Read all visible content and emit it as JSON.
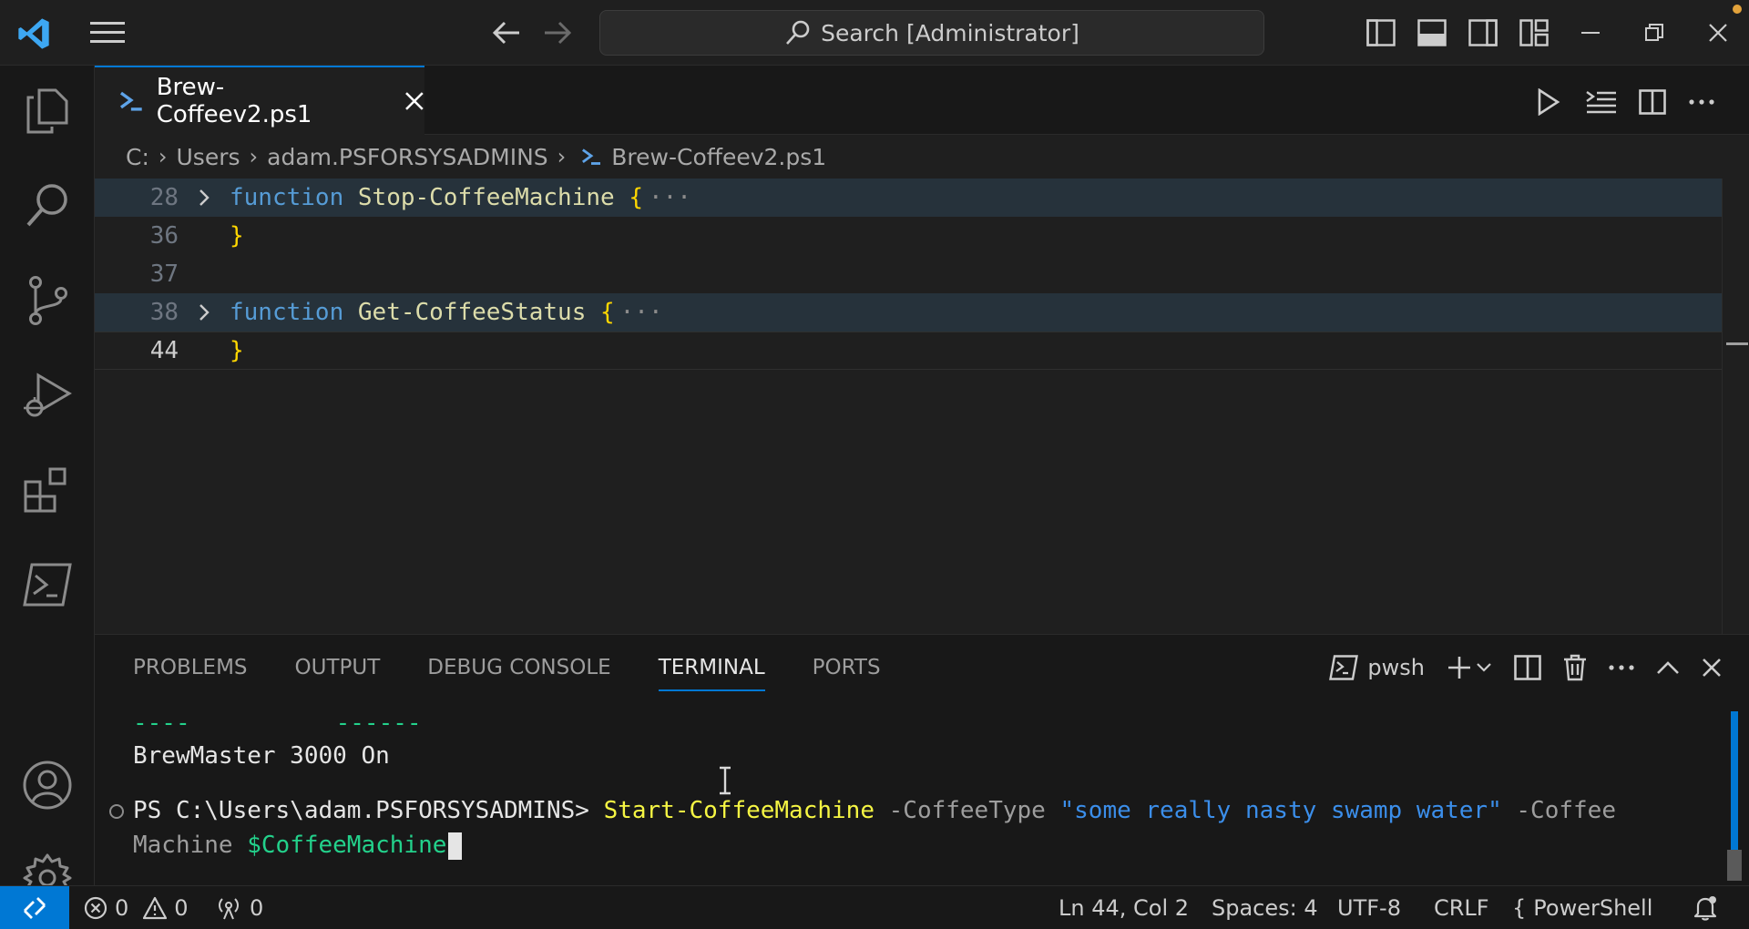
{
  "titlebar": {
    "search_text": "Search [Administrator]"
  },
  "tab": {
    "filename": "Brew-Coffeev2.ps1"
  },
  "breadcrumbs": [
    "C:",
    "Users",
    "adam.PSFORSYSADMINS",
    "Brew-Coffeev2.ps1"
  ],
  "code": {
    "lines": [
      {
        "num": "28",
        "kw": "function",
        "name": "Stop-CoffeeMachine",
        "brace": "{",
        "ellipsis": "···"
      },
      {
        "num": "36",
        "brace": "}"
      },
      {
        "num": "37"
      },
      {
        "num": "38",
        "kw": "function",
        "name": "Get-CoffeeStatus",
        "brace": "{",
        "ellipsis": "···"
      },
      {
        "num": "44",
        "brace": "}"
      }
    ]
  },
  "panel": {
    "tabs": [
      "PROBLEMS",
      "OUTPUT",
      "DEBUG CONSOLE",
      "TERMINAL",
      "PORTS"
    ],
    "shell_name": "pwsh"
  },
  "terminal": {
    "dash1": "----",
    "dash2": "------",
    "output": "BrewMaster 3000 On",
    "prompt": "PS C:\\Users\\adam.PSFORSYSADMINS> ",
    "command": "Start-CoffeeMachine",
    "param1": " -CoffeeType ",
    "string": "\"some really nasty swamp water\"",
    "param2_part1": " -Coffee",
    "param2_part2": "Machine ",
    "variable": "$CoffeeMachine"
  },
  "statusbar": {
    "errors": "0",
    "warnings": "0",
    "ports": "0",
    "position": "Ln 44, Col 2",
    "spaces": "Spaces: 4",
    "encoding": "UTF-8",
    "eol": "CRLF",
    "language": "PowerShell"
  },
  "colors": {
    "accent": "#0078d4",
    "keyword": "#569cd6",
    "function": "#dcdcaa",
    "bracket": "#ffd700"
  }
}
